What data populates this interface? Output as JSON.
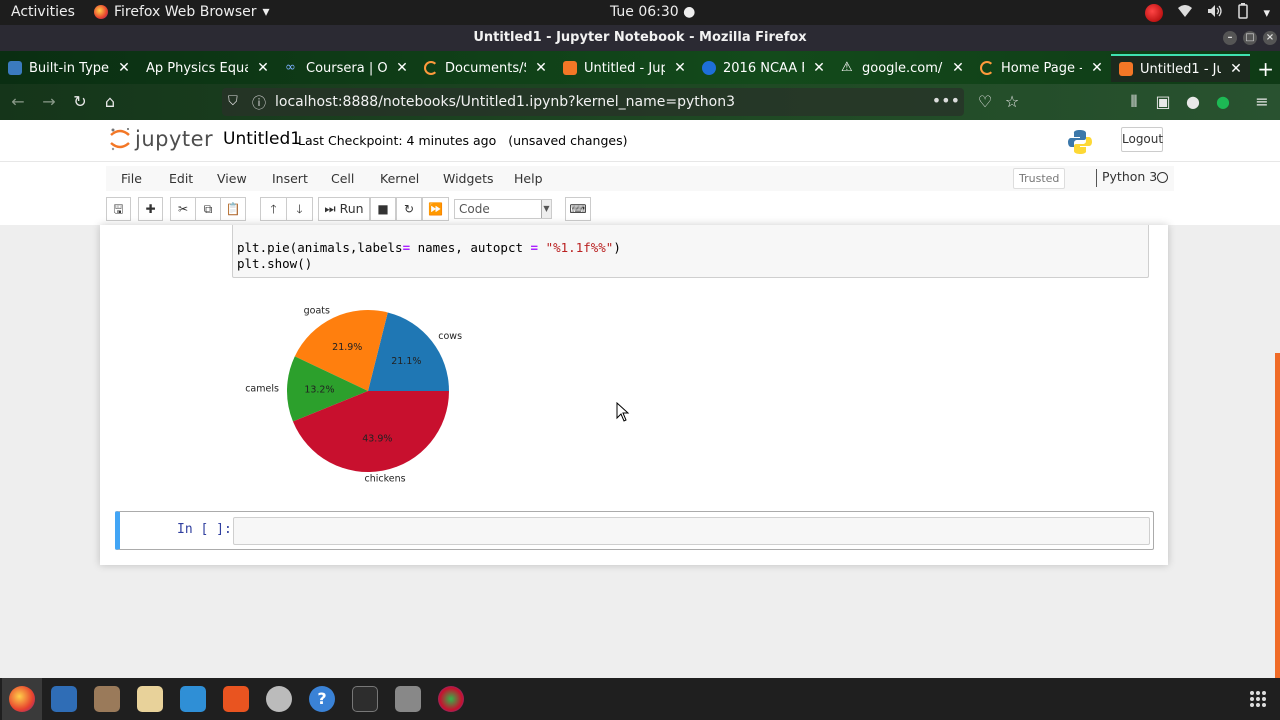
{
  "system": {
    "activities": "Activities",
    "app_name": "Firefox Web Browser",
    "clock": "Tue 06:30 ●"
  },
  "window": {
    "title": "Untitled1 - Jupyter Notebook - Mozilla Firefox"
  },
  "tabs": [
    {
      "label": "Built-in Type",
      "icon": "python-icon",
      "icon_color": "#3b7bbf"
    },
    {
      "label": "Ap Physics Equa",
      "icon": "none",
      "icon_color": ""
    },
    {
      "label": "Coursera | Or",
      "icon": "link-icon",
      "icon_color": "#7cb1ff"
    },
    {
      "label": "Documents/S",
      "icon": "loading-icon",
      "icon_color": "#ff9a3c"
    },
    {
      "label": "Untitled - Jup",
      "icon": "jupyter-book-icon",
      "icon_color": "#f37726"
    },
    {
      "label": "2016 NCAA F",
      "icon": "globe-icon",
      "icon_color": "#1e6fd9"
    },
    {
      "label": "google.com/",
      "icon": "warning-icon",
      "icon_color": "#ffffff"
    },
    {
      "label": "Home Page -",
      "icon": "loading-icon",
      "icon_color": "#ff9a3c"
    },
    {
      "label": "Untitled1 - Ju",
      "icon": "jupyter-book-icon",
      "icon_color": "#f37726"
    }
  ],
  "navbar": {
    "url": "localhost:8888/notebooks/Untitled1.ipynb?kernel_name=python3"
  },
  "jupyter": {
    "logo_text": "jupyter",
    "notebook_name": "Untitled1",
    "checkpoint": "Last Checkpoint: 4 minutes ago",
    "unsaved": "(unsaved changes)",
    "logout_label": "Logout",
    "menu": [
      "File",
      "Edit",
      "View",
      "Insert",
      "Cell",
      "Kernel",
      "Widgets",
      "Help"
    ],
    "trusted_label": "Trusted",
    "kernel_name": "Python 3",
    "run_label": "Run",
    "cell_type": "Code",
    "code_line1_a": "plt.pie(animals,labels",
    "code_line1_op1": "=",
    "code_line1_b": " names, autopct ",
    "code_line1_op2": "=",
    "code_line1_str": " \"%1.1f%%\"",
    "code_line1_c": ")",
    "code_line2": "plt.show()",
    "input_prompt": "In [ ]:"
  },
  "chart_data": {
    "type": "pie",
    "slices": [
      {
        "label": "cows",
        "value": 21.1,
        "pct_label": "21.1%",
        "color": "#1f77b4"
      },
      {
        "label": "goats",
        "value": 21.9,
        "pct_label": "21.9%",
        "color": "#ff7f0e"
      },
      {
        "label": "camels",
        "value": 13.2,
        "pct_label": "13.2%",
        "color": "#2ca02c"
      },
      {
        "label": "chickens",
        "value": 43.9,
        "pct_label": "43.9%",
        "color": "#c8102e"
      }
    ],
    "start_angle_deg": 0,
    "direction": "counterclockwise",
    "title": ""
  },
  "colors": {
    "jupyter_orange": "#f37726",
    "edit_mode_border": "#42a5f5",
    "prompt_blue": "#303f9f"
  }
}
